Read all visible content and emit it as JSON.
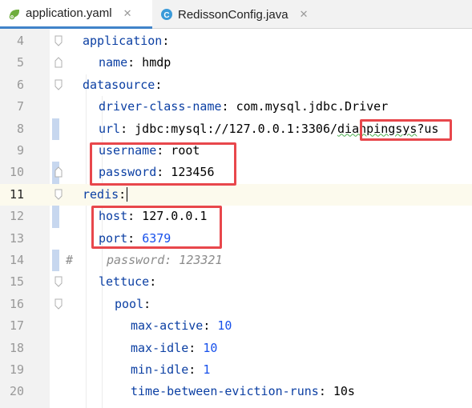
{
  "tabs": [
    {
      "label": "application.yaml",
      "active": true,
      "icon": "yaml-file-icon"
    },
    {
      "label": "RedissonConfig.java",
      "active": false,
      "icon": "java-class-icon"
    }
  ],
  "close_glyph": "✕",
  "lines": [
    {
      "num": "4",
      "t0": "application",
      "t1": ":"
    },
    {
      "num": "5",
      "t0": "name",
      "t1": ": hmdp"
    },
    {
      "num": "6",
      "t0": "datasource",
      "t1": ":"
    },
    {
      "num": "7",
      "t0": "driver-class-name",
      "t1": ": com.mysql.jdbc.Driver"
    },
    {
      "num": "8",
      "t0": "url",
      "t1": ": jdbc:mysql://127.0.0.1:3306/",
      "t2": "dianpingsys",
      "t3": "?us"
    },
    {
      "num": "9",
      "t0": "username",
      "t1": ": root"
    },
    {
      "num": "10",
      "t0": "password",
      "t1": ": 123456"
    },
    {
      "num": "11",
      "t0": "redis",
      "t1": ":"
    },
    {
      "num": "12",
      "t0": "host",
      "t1": ": 127.0.0.1"
    },
    {
      "num": "13",
      "t0": "port",
      "t1": ": ",
      "t2": "6379"
    },
    {
      "num": "14",
      "hash": "#",
      "comment": "password: 123321"
    },
    {
      "num": "15",
      "t0": "lettuce",
      "t1": ":"
    },
    {
      "num": "16",
      "t0": "pool",
      "t1": ":"
    },
    {
      "num": "17",
      "t0": "max-active",
      "t1": ": ",
      "t2": "10"
    },
    {
      "num": "18",
      "t0": "max-idle",
      "t1": ": ",
      "t2": "10"
    },
    {
      "num": "19",
      "t0": "min-idle",
      "t1": ": ",
      "t2": "1"
    },
    {
      "num": "20",
      "t0": "time-between-eviction-runs",
      "t1": ": 10s"
    }
  ],
  "colors": {
    "key": "#0b3fa3",
    "number": "#1750eb",
    "comment": "#8c8c8c",
    "highlight_box": "#e8474c",
    "active_tab_underline": "#4083c9"
  }
}
